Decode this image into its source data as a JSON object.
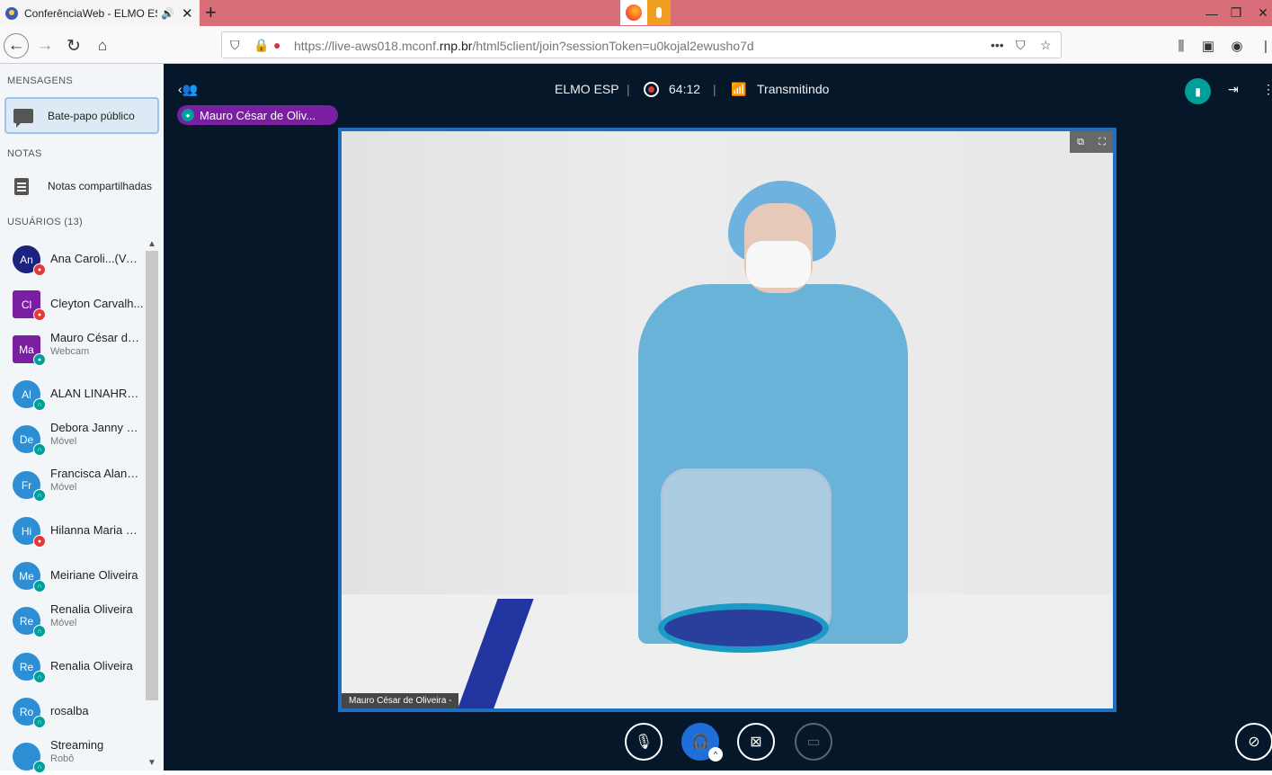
{
  "browser": {
    "tab_title": "ConferênciaWeb - ELMO ES",
    "tab_close": "✕",
    "tab_audio_icon": "speaker-icon",
    "new_tab": "+",
    "url_prefix": "https://live-aws018.mconf.",
    "url_domain": "rnp.br",
    "url_suffix": "/html5client/join?sessionToken=u0kojal2ewusho7d",
    "window_controls": [
      "—",
      "❐",
      "✕"
    ]
  },
  "sidebar": {
    "messages_heading": "MENSAGENS",
    "public_chat": "Bate-papo público",
    "notes_heading": "NOTAS",
    "shared_notes": "Notas compartilhadas",
    "users_heading": "USUÁRIOS  (13)",
    "users": [
      {
        "initials": "An",
        "name": "Ana Caroli...(Você)",
        "sub": "",
        "color": "#1a237e",
        "status": "muted",
        "square": false
      },
      {
        "initials": "Cl",
        "name": "Cleyton Carvalh...",
        "sub": "",
        "color": "#7b1fa2",
        "status": "muted",
        "square": true
      },
      {
        "initials": "Ma",
        "name": "Mauro César de ...",
        "sub": "Webcam",
        "color": "#7b1fa2",
        "status": "mic",
        "square": true
      },
      {
        "initials": "Al",
        "name": "ALAN LINAHRE...",
        "sub": "",
        "color": "#2d8ed4",
        "status": "listen",
        "square": false
      },
      {
        "initials": "De",
        "name": "Debora Janny Be...",
        "sub": "Móvel",
        "color": "#2d8ed4",
        "status": "listen",
        "square": false
      },
      {
        "initials": "Fr",
        "name": "Francisca Alana ...",
        "sub": "Móvel",
        "color": "#2d8ed4",
        "status": "listen",
        "square": false
      },
      {
        "initials": "Hi",
        "name": "Hilanna Maria M...",
        "sub": "",
        "color": "#2d8ed4",
        "status": "muted",
        "square": false
      },
      {
        "initials": "Me",
        "name": "Meiriane Oliveira",
        "sub": "",
        "color": "#2d8ed4",
        "status": "listen",
        "square": false
      },
      {
        "initials": "Re",
        "name": "Renalia Oliveira",
        "sub": "Móvel",
        "color": "#2d8ed4",
        "status": "listen",
        "square": false
      },
      {
        "initials": "Re",
        "name": "Renalia Oliveira",
        "sub": "",
        "color": "#2d8ed4",
        "status": "listen",
        "square": false
      },
      {
        "initials": "Ro",
        "name": "rosalba",
        "sub": "",
        "color": "#2d8ed4",
        "status": "listen",
        "square": false
      },
      {
        "initials": "",
        "name": "Streaming",
        "sub": "Robô",
        "color": "#2d8ed4",
        "status": "listen",
        "square": false
      }
    ]
  },
  "meeting": {
    "title": "ELMO ESP",
    "timer": "64:12",
    "broadcast_status": "Transmitindo",
    "talking_pill": "Mauro César de Oliv...",
    "video_label": "Mauro César de Oliveira  -",
    "colors": {
      "bg": "#06172a",
      "accent": "#1e6fd9",
      "teal": "#00a09a",
      "record": "#e53935"
    }
  },
  "controls": {
    "mute_icon": "mic-off-icon",
    "audio_icon": "headphones-icon",
    "video_icon": "camera-off-icon",
    "screen_icon": "screen-share-icon",
    "caret": "^",
    "hide_presentation_icon": "hide-presentation-icon"
  }
}
